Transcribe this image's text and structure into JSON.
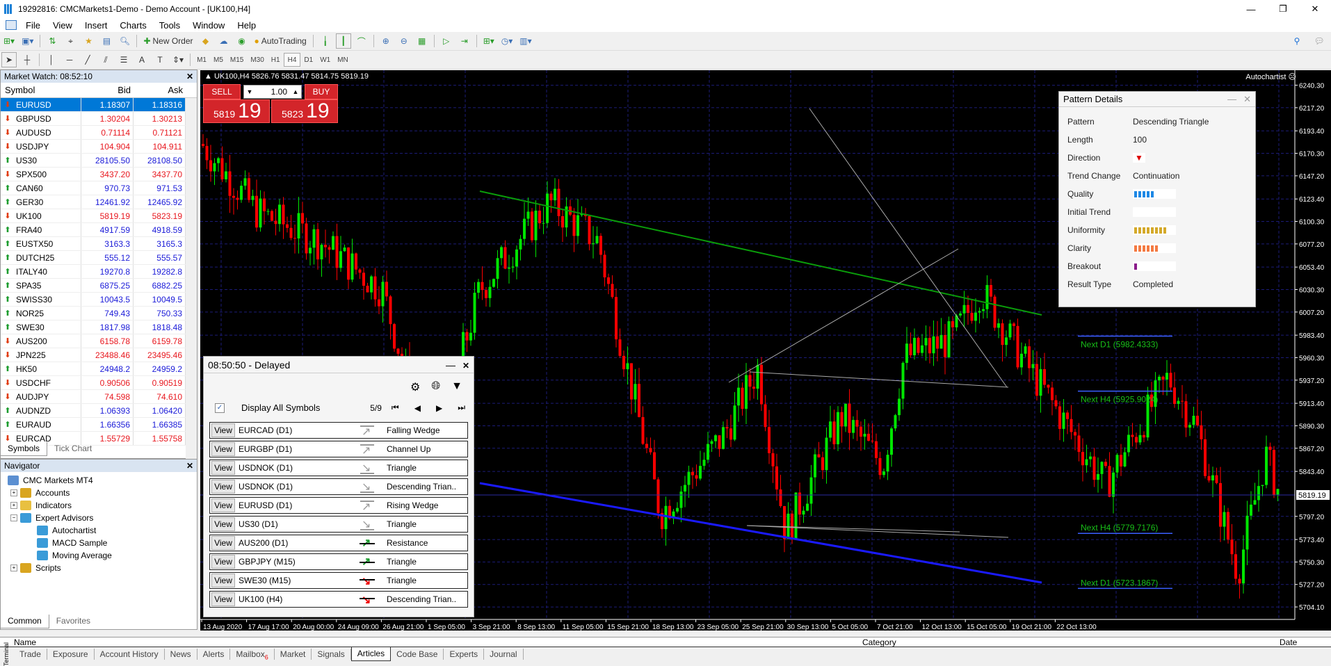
{
  "window": {
    "title": "19292816: CMCMarkets1-Demo - Demo Account - [UK100,H4]",
    "min": "—",
    "restore": "❐",
    "close": "✕"
  },
  "menu": [
    "File",
    "View",
    "Insert",
    "Charts",
    "Tools",
    "Window",
    "Help"
  ],
  "toolbar": {
    "new_order": "New Order",
    "autotrading": "AutoTrading"
  },
  "timeframes": [
    "M1",
    "M5",
    "M15",
    "M30",
    "H1",
    "H4",
    "D1",
    "W1",
    "MN"
  ],
  "active_timeframe": "H4",
  "market_watch": {
    "title": "Market Watch: 08:52:10",
    "columns": [
      "Symbol",
      "Bid",
      "Ask"
    ],
    "rows": [
      {
        "symbol": "EURUSD",
        "bid": "1.18307",
        "ask": "1.18316",
        "dir": "down",
        "selected": true
      },
      {
        "symbol": "GBPUSD",
        "bid": "1.30204",
        "ask": "1.30213",
        "dir": "down"
      },
      {
        "symbol": "AUDUSD",
        "bid": "0.71114",
        "ask": "0.71121",
        "dir": "down"
      },
      {
        "symbol": "USDJPY",
        "bid": "104.904",
        "ask": "104.911",
        "dir": "down"
      },
      {
        "symbol": "US30",
        "bid": "28105.50",
        "ask": "28108.50",
        "dir": "up"
      },
      {
        "symbol": "SPX500",
        "bid": "3437.20",
        "ask": "3437.70",
        "dir": "down"
      },
      {
        "symbol": "CAN60",
        "bid": "970.73",
        "ask": "971.53",
        "dir": "up"
      },
      {
        "symbol": "GER30",
        "bid": "12461.92",
        "ask": "12465.92",
        "dir": "up"
      },
      {
        "symbol": "UK100",
        "bid": "5819.19",
        "ask": "5823.19",
        "dir": "down"
      },
      {
        "symbol": "FRA40",
        "bid": "4917.59",
        "ask": "4918.59",
        "dir": "up"
      },
      {
        "symbol": "EUSTX50",
        "bid": "3163.3",
        "ask": "3165.3",
        "dir": "up"
      },
      {
        "symbol": "DUTCH25",
        "bid": "555.12",
        "ask": "555.57",
        "dir": "up"
      },
      {
        "symbol": "ITALY40",
        "bid": "19270.8",
        "ask": "19282.8",
        "dir": "up"
      },
      {
        "symbol": "SPA35",
        "bid": "6875.25",
        "ask": "6882.25",
        "dir": "up"
      },
      {
        "symbol": "SWISS30",
        "bid": "10043.5",
        "ask": "10049.5",
        "dir": "up"
      },
      {
        "symbol": "NOR25",
        "bid": "749.43",
        "ask": "750.33",
        "dir": "up"
      },
      {
        "symbol": "SWE30",
        "bid": "1817.98",
        "ask": "1818.48",
        "dir": "up"
      },
      {
        "symbol": "AUS200",
        "bid": "6158.78",
        "ask": "6159.78",
        "dir": "down"
      },
      {
        "symbol": "JPN225",
        "bid": "23488.46",
        "ask": "23495.46",
        "dir": "down"
      },
      {
        "symbol": "HK50",
        "bid": "24948.2",
        "ask": "24959.2",
        "dir": "up"
      },
      {
        "symbol": "USDCHF",
        "bid": "0.90506",
        "ask": "0.90519",
        "dir": "down"
      },
      {
        "symbol": "AUDJPY",
        "bid": "74.598",
        "ask": "74.610",
        "dir": "down"
      },
      {
        "symbol": "AUDNZD",
        "bid": "1.06393",
        "ask": "1.06420",
        "dir": "up"
      },
      {
        "symbol": "EURAUD",
        "bid": "1.66356",
        "ask": "1.66385",
        "dir": "up"
      },
      {
        "symbol": "EURCAD",
        "bid": "1.55729",
        "ask": "1.55758",
        "dir": "down"
      }
    ],
    "tabs": [
      "Symbols",
      "Tick Chart"
    ]
  },
  "navigator": {
    "title": "Navigator",
    "items": [
      {
        "label": "CMC Markets MT4",
        "level": 0
      },
      {
        "label": "Accounts",
        "level": 1
      },
      {
        "label": "Indicators",
        "level": 1
      },
      {
        "label": "Expert Advisors",
        "level": 1
      },
      {
        "label": "Autochartist",
        "level": 2
      },
      {
        "label": "MACD Sample",
        "level": 2
      },
      {
        "label": "Moving Average",
        "level": 2
      },
      {
        "label": "Scripts",
        "level": 1
      }
    ],
    "tabs": [
      "Common",
      "Favorites"
    ]
  },
  "chart": {
    "info": "▲ UK100,H4  5826.76 5831.47 5814.75 5819.19",
    "autochartist_label": "Autochartist ☹",
    "one_click": {
      "sell": "SELL",
      "buy": "BUY",
      "lot": "1.00",
      "sell_small": "5819",
      "sell_big": "19",
      "buy_small": "5823",
      "buy_big": "19"
    },
    "price_axis": [
      "6240.30",
      "6217.20",
      "6193.40",
      "6170.30",
      "6147.20",
      "6123.40",
      "6100.30",
      "6077.20",
      "6053.40",
      "6030.30",
      "6007.20",
      "5983.40",
      "5960.30",
      "5937.20",
      "5913.40",
      "5890.30",
      "5867.20",
      "5843.40",
      "5819.19",
      "5797.20",
      "5773.40",
      "5750.30",
      "5727.20",
      "5704.10"
    ],
    "current_price": "5819.19",
    "time_axis": [
      "13 Aug 2020",
      "17 Aug 17:00",
      "20 Aug 00:00",
      "24 Aug 09:00",
      "26 Aug 21:00",
      "1 Sep 05:00",
      "3 Sep 21:00",
      "8 Sep 13:00",
      "11 Sep 05:00",
      "15 Sep 21:00",
      "18 Sep 13:00",
      "23 Sep 05:00",
      "25 Sep 21:00",
      "30 Sep 13:00",
      "5 Oct 05:00",
      "7 Oct 21:00",
      "12 Oct 13:00",
      "15 Oct 05:00",
      "19 Oct 21:00",
      "22 Oct 13:00"
    ],
    "levels": [
      {
        "label": "Next D1 (5982.4333)",
        "price": 5982.4333
      },
      {
        "label": "Next H4 (5925.9024)",
        "price": 5925.9024
      },
      {
        "label": "Next H4 (5779.7176)",
        "price": 5779.7176
      },
      {
        "label": "Next D1 (5723.1867)",
        "price": 5723.1867
      }
    ]
  },
  "autochartist": {
    "title": "08:50:50 - Delayed",
    "display_all": "Display All Symbols",
    "page": "5/9",
    "rows": [
      {
        "symbol": "EURCAD (D1)",
        "pattern": "Falling Wedge",
        "icon": "up-gray"
      },
      {
        "symbol": "EURGBP (D1)",
        "pattern": "Channel Up",
        "icon": "up-gray"
      },
      {
        "symbol": "USDNOK (D1)",
        "pattern": "Triangle",
        "icon": "down-gray"
      },
      {
        "symbol": "USDNOK (D1)",
        "pattern": "Descending Trian..",
        "icon": "down-gray"
      },
      {
        "symbol": "EURUSD (D1)",
        "pattern": "Rising Wedge",
        "icon": "up-gray"
      },
      {
        "symbol": "US30 (D1)",
        "pattern": "Triangle",
        "icon": "down-gray"
      },
      {
        "symbol": "AUS200 (D1)",
        "pattern": "Resistance",
        "icon": "up-green"
      },
      {
        "symbol": "GBPJPY (M15)",
        "pattern": "Triangle",
        "icon": "up-green"
      },
      {
        "symbol": "SWE30 (M15)",
        "pattern": "Triangle",
        "icon": "down-red"
      },
      {
        "symbol": "UK100 (H4)",
        "pattern": "Descending Trian..",
        "icon": "down-red"
      }
    ],
    "view_label": "View"
  },
  "pattern_details": {
    "title": "Pattern Details",
    "rows": [
      {
        "label": "Pattern",
        "value": "Descending Triangle"
      },
      {
        "label": "Length",
        "value": "100"
      },
      {
        "label": "Direction",
        "value": "▼"
      },
      {
        "label": "Trend Change",
        "value": "Continuation"
      },
      {
        "label": "Quality",
        "bars": 5,
        "color": "#1e88e5"
      },
      {
        "label": "Initial Trend",
        "bars": 0,
        "color": "#1e88e5"
      },
      {
        "label": "Uniformity",
        "bars": 8,
        "color": "#d4a92a"
      },
      {
        "label": "Clarity",
        "bars": 6,
        "color": "#f47a42"
      },
      {
        "label": "Breakout",
        "bars": 1,
        "color": "#8a1a8a"
      },
      {
        "label": "Result Type",
        "value": "Completed"
      }
    ]
  },
  "terminal": {
    "columns": [
      "Name",
      "Category",
      "Date"
    ],
    "tabs": [
      "Trade",
      "Exposure",
      "Account History",
      "News",
      "Alerts",
      "Mailbox",
      "Market",
      "Signals",
      "Articles",
      "Code Base",
      "Experts",
      "Journal"
    ],
    "mailbox_badge": "6",
    "active_tab": "Articles",
    "side_label": "Terminal"
  }
}
